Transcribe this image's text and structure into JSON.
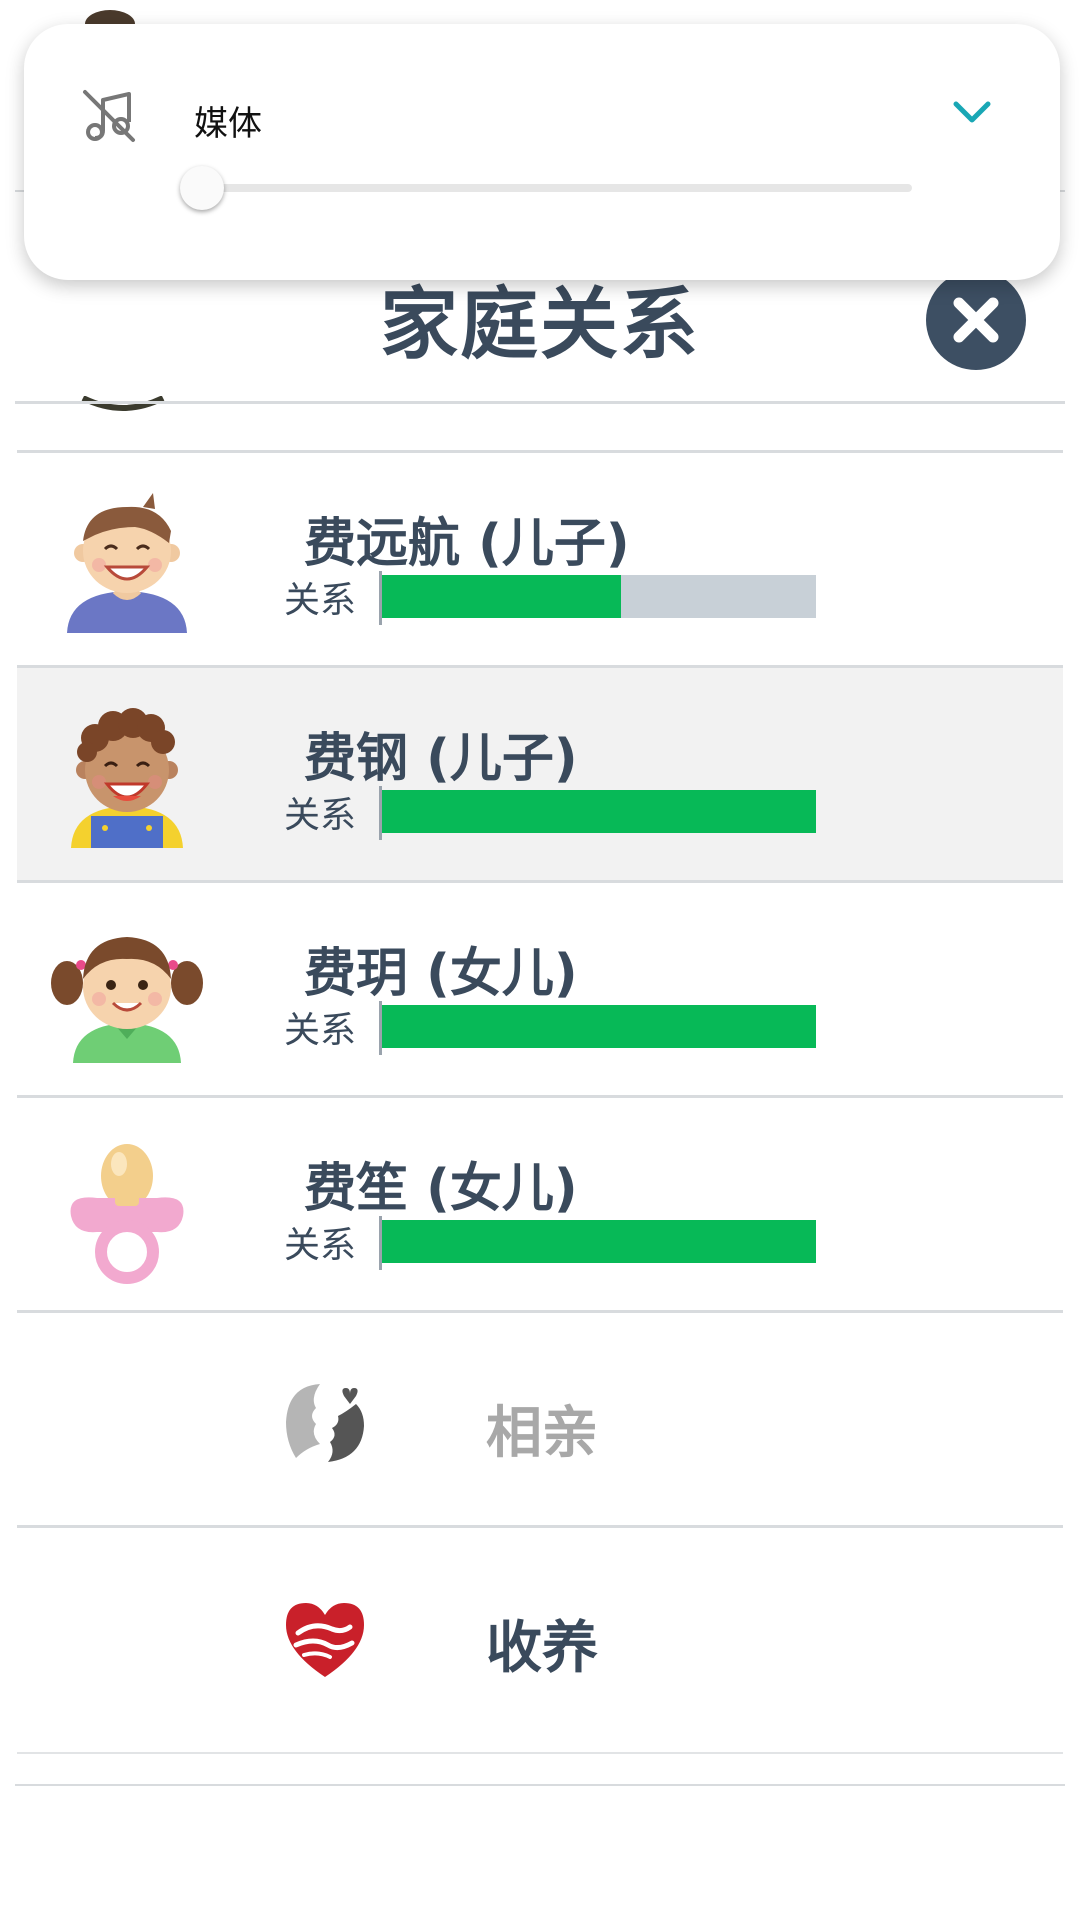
{
  "header": {
    "title": "家庭关系"
  },
  "children": [
    {
      "name": "费远航 (儿子)",
      "relation_label": "关系",
      "relation_level": 0.55,
      "avatar": "boy-brown-hair-avatar",
      "selected": false
    },
    {
      "name": "费钢 (儿子)",
      "relation_label": "关系",
      "relation_level": 1.0,
      "avatar": "boy-curly-hair-avatar",
      "selected": true
    },
    {
      "name": "费玥 (女儿)",
      "relation_label": "关系",
      "relation_level": 1.0,
      "avatar": "girl-pigtails-avatar",
      "selected": false
    },
    {
      "name": "费笙 (女儿)",
      "relation_label": "关系",
      "relation_level": 1.0,
      "avatar": "pacifier-avatar",
      "selected": false
    }
  ],
  "actions": [
    {
      "label": "相亲",
      "icon": "couple-kiss-icon",
      "enabled": false
    },
    {
      "label": "收养",
      "icon": "heart-hands-icon",
      "enabled": true
    }
  ],
  "volume": {
    "label": "媒体",
    "level": 0,
    "icon": "music-muted-icon",
    "expand_icon": "chevron-down-icon"
  },
  "colors": {
    "bar_fill": "#07b957",
    "bar_empty": "#c8d0d7",
    "text": "#3a4a5c",
    "close_bg": "#3d4f63",
    "accent": "#19a7b5"
  }
}
